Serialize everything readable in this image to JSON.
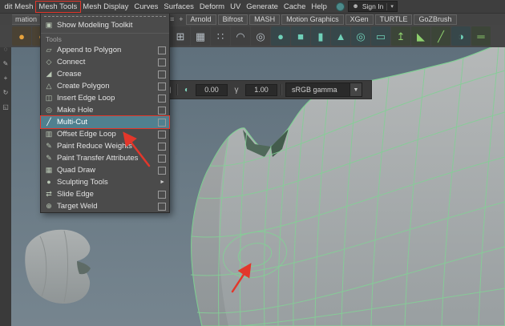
{
  "colors": {
    "annotation": "#e2372b",
    "menu_highlight": "#50808f",
    "wireframe_green": "#84cf96",
    "viewport_bg": "#6e7f8c"
  },
  "menubar": {
    "items": [
      {
        "label": "dit Mesh"
      },
      {
        "label": "Mesh Tools",
        "boxed": true
      },
      {
        "label": "Mesh Display"
      },
      {
        "label": "Curves"
      },
      {
        "label": "Surfaces"
      },
      {
        "label": "Deform"
      },
      {
        "label": "UV"
      },
      {
        "label": "Generate"
      },
      {
        "label": "Cache"
      },
      {
        "label": "Help"
      }
    ],
    "sign_in": {
      "person_glyph": "☻",
      "label": "Sign In",
      "caret": "▾"
    }
  },
  "shelf_tabs": {
    "partial_tab": "mation",
    "menu_icon": "≡",
    "add_icon": "+",
    "tabs": [
      "Arnold",
      "Bifrost",
      "MASH",
      "Motion Graphics",
      "XGen",
      "TURTLE",
      "GoZBrush"
    ]
  },
  "shelf": {
    "icons": [
      {
        "name": "shaded-sphere-icon",
        "glyph": "●"
      },
      {
        "name": "textured-sphere-icon",
        "glyph": "◐"
      },
      {
        "name": "mash-network-icon",
        "glyph": "⊞"
      },
      {
        "name": "mash-grid-icon",
        "glyph": "▦"
      },
      {
        "name": "mash-points-icon",
        "glyph": "∷"
      },
      {
        "name": "mash-curve-icon",
        "glyph": "◠"
      },
      {
        "name": "mash-world-icon",
        "glyph": "◎"
      },
      {
        "name": "poly-sphere-icon",
        "glyph": "●"
      },
      {
        "name": "poly-cube-icon",
        "glyph": "■"
      },
      {
        "name": "poly-cylinder-icon",
        "glyph": "▮"
      },
      {
        "name": "poly-cone-icon",
        "glyph": "▲"
      },
      {
        "name": "poly-torus-icon",
        "glyph": "◎"
      },
      {
        "name": "poly-plane-icon",
        "glyph": "▭"
      },
      {
        "name": "extrude-icon",
        "glyph": "↥"
      },
      {
        "name": "bevel-icon",
        "glyph": "◣"
      },
      {
        "name": "multi-cut-shelf-icon",
        "glyph": "╱"
      },
      {
        "name": "smooth-icon",
        "glyph": "◑"
      },
      {
        "name": "bridge-icon",
        "glyph": "═"
      }
    ]
  },
  "toolbox": {
    "icons": [
      {
        "name": "select-tool-icon",
        "glyph": "▶"
      },
      {
        "name": "lasso-tool-icon",
        "glyph": "◌"
      },
      {
        "name": "paint-select-tool-icon",
        "glyph": "✎"
      },
      {
        "name": "move-tool-icon",
        "glyph": "+"
      },
      {
        "name": "rotate-tool-icon",
        "glyph": "↻"
      },
      {
        "name": "scale-tool-icon",
        "glyph": "◱"
      }
    ]
  },
  "viewport_toolbar": {
    "icons": [
      {
        "name": "renderer-icon",
        "glyph": "▤"
      },
      {
        "name": "lighting-icon",
        "glyph": "◧"
      },
      {
        "name": "shadows-icon",
        "glyph": "◨"
      },
      {
        "name": "exposure-icon",
        "glyph": "◐"
      },
      {
        "name": "gamma-icon",
        "glyph": "γ"
      }
    ],
    "exposure_value": "0.00",
    "gamma_value": "1.00",
    "view_transform_label": "sRGB gamma",
    "dropdown_caret": "▼"
  },
  "mesh_tools_menu": {
    "toolkit_item": "Show Modeling Toolkit",
    "toolkit_glyph": "▣",
    "section_label": "Tools",
    "submenu_arrow": "►",
    "items": [
      {
        "label": "Append to Polygon",
        "glyph": "▱",
        "option_box": true
      },
      {
        "label": "Connect",
        "glyph": "◇",
        "option_box": true
      },
      {
        "label": "Crease",
        "glyph": "◢",
        "option_box": true
      },
      {
        "label": "Create Polygon",
        "glyph": "△",
        "option_box": true
      },
      {
        "label": "Insert Edge Loop",
        "glyph": "◫",
        "option_box": true
      },
      {
        "label": "Make Hole",
        "glyph": "◎",
        "option_box": true
      },
      {
        "label": "Multi-Cut",
        "glyph": "╱",
        "option_box": true,
        "highlighted": true
      },
      {
        "label": "Offset Edge Loop",
        "glyph": "▥",
        "option_box": true
      },
      {
        "label": "Paint Reduce Weights",
        "glyph": "✎",
        "option_box": true
      },
      {
        "label": "Paint Transfer Attributes",
        "glyph": "✎",
        "option_box": true
      },
      {
        "label": "Quad Draw",
        "glyph": "▦",
        "option_box": true
      },
      {
        "label": "Sculpting Tools",
        "glyph": "●",
        "submenu": true
      },
      {
        "label": "Slide Edge",
        "glyph": "⇄",
        "option_box": true
      },
      {
        "label": "Target Weld",
        "glyph": "⊕",
        "option_box": true
      }
    ]
  }
}
